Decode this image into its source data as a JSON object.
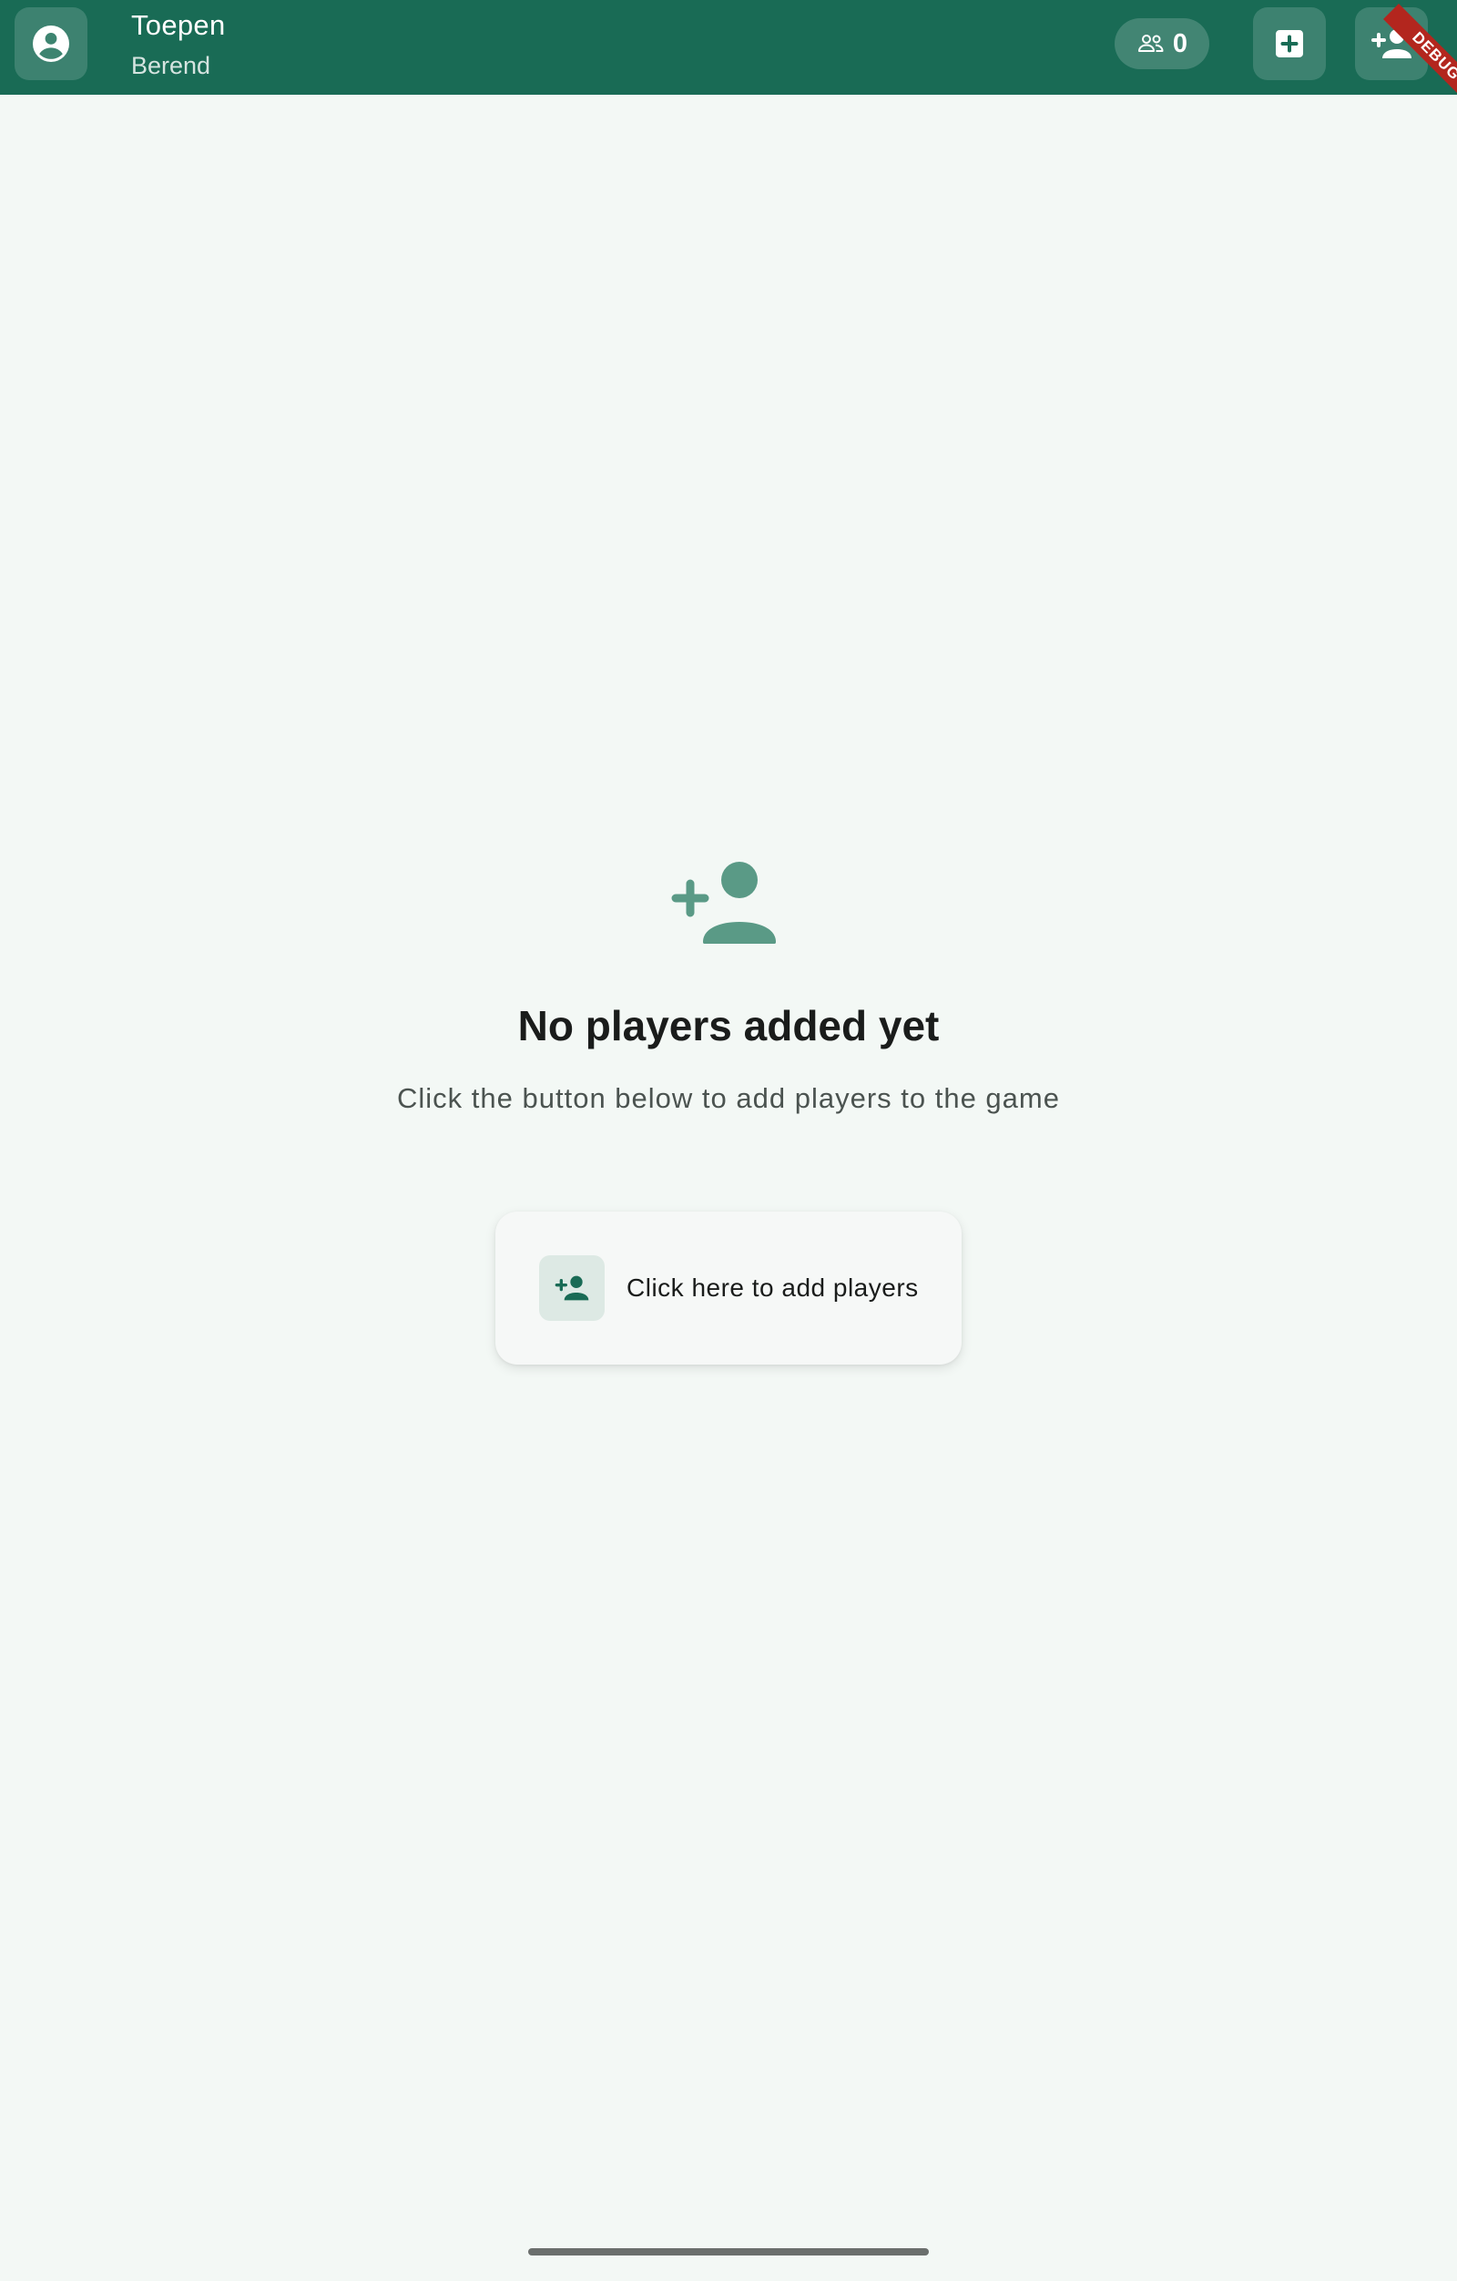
{
  "header": {
    "title": "Toepen",
    "subtitle": "Berend",
    "player_count": "0",
    "profile_icon": "account-circle-icon",
    "players_icon": "group-icon",
    "new_game_icon": "add-box-icon",
    "add_player_icon": "person-add-icon",
    "debug_banner": "DEBUG"
  },
  "empty_state": {
    "icon": "person-add-icon",
    "title": "No players added yet",
    "subtitle": "Click the button below to add players to the game",
    "button_label": "Click here to add players",
    "button_icon": "person-add-icon"
  },
  "colors": {
    "app_bar": "#196b55",
    "background": "#f3f8f5",
    "icon_muted": "#5a9a86",
    "accent": "#196b55"
  }
}
